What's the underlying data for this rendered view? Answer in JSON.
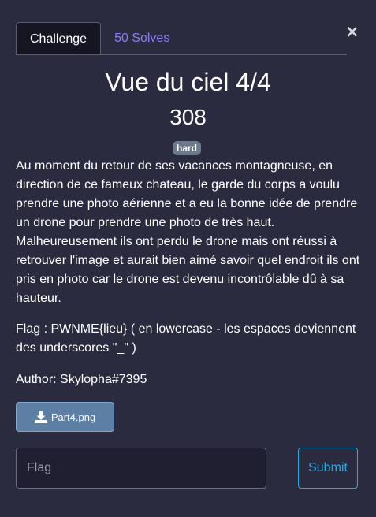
{
  "modal": {
    "close_symbol": "×"
  },
  "tabs": [
    {
      "label": "Challenge"
    },
    {
      "label": "50 Solves"
    }
  ],
  "challenge": {
    "title": "Vue du ciel 4/4",
    "points": "308",
    "difficulty": "hard",
    "description": "Au moment du retour de ses vacances montagneuse, en direction de ce fameux chateau, le garde du corps a voulu prendre une photo aérienne et a eu la bonne idée de prendre un drone pour prendre une photo de très haut. Malheureusement ils ont perdu le drone mais ont réussi à retrouver l'image et aurait bien aimé savoir quel endroit ils ont pris en photo car le drone est devenu incontrôlable dû à sa hauteur.",
    "flag_format": "Flag : PWNME{lieu} ( en lowercase - les espaces deviennent des underscores \"_\" )",
    "author": "Author: Skylopha#7395",
    "file": {
      "name": "Part4.png",
      "icon": "download-icon"
    }
  },
  "form": {
    "flag_placeholder": "Flag",
    "flag_value": "",
    "submit_label": "Submit"
  },
  "colors": {
    "background": "#2b2b40",
    "active_tab": "#161622",
    "inactive_tab_text": "#8b7cf6",
    "badge": "#6c7a8c",
    "file_button": "#5d7fa3",
    "submit_accent": "#2ea6e0"
  }
}
